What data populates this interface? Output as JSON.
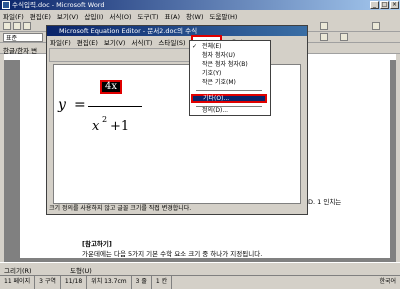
{
  "app": {
    "title": "수식입력.doc - Microsoft Word",
    "menu": [
      "파일(F)",
      "편집(E)",
      "보기(V)",
      "삽입(I)",
      "서식(O)",
      "도구(T)",
      "표(A)",
      "창(W)",
      "도움말(H)"
    ],
    "style_combo": "표준",
    "doc_fragment_left": "한글/한자 변",
    "doc_fragment_right": "D. 1 인치는",
    "note_header": "[참고하기]",
    "note_text": "가운데에는 다음 5가지 기본 수학 요소 크기 중 하나가 지정됩니다.",
    "drawing_label": "그리기(R)",
    "autoshapes_label": "도형(U)"
  },
  "statusbar": [
    "11 페이지",
    "3 구역",
    "11/18",
    "위치 13.7cm",
    "3 줄",
    "1 칸",
    "",
    "",
    "",
    "한국어"
  ],
  "equation_editor": {
    "title": "Microsoft Equation Editor - 문서2.doc의 수식",
    "menu": [
      "파일(F)",
      "편집(E)",
      "보기(V)",
      "서식(T)",
      "스타일(S)",
      "크기(Z)",
      "도움말(H)"
    ],
    "active_menu": "크기(Z)",
    "status": "크기 정의를 사용하지 않고 글꼴 크기를 직접 변경합니다.",
    "formula": {
      "lhs": "y",
      "eq": "=",
      "numerator": "4x",
      "denominator_base": "x",
      "denominator_exp": "2",
      "denominator_rest": "+1"
    }
  },
  "size_menu": {
    "items": [
      {
        "label": "전체(E)",
        "checked": true
      },
      {
        "label": "첨자 첨자(U)",
        "checked": false
      },
      {
        "label": "작은 첨자 첨자(B)",
        "checked": false
      },
      {
        "label": "기호(Y)",
        "checked": false
      },
      {
        "label": "작은 기호(M)",
        "checked": false
      }
    ],
    "other": "기타(O)...",
    "define": "정의(D)..."
  }
}
